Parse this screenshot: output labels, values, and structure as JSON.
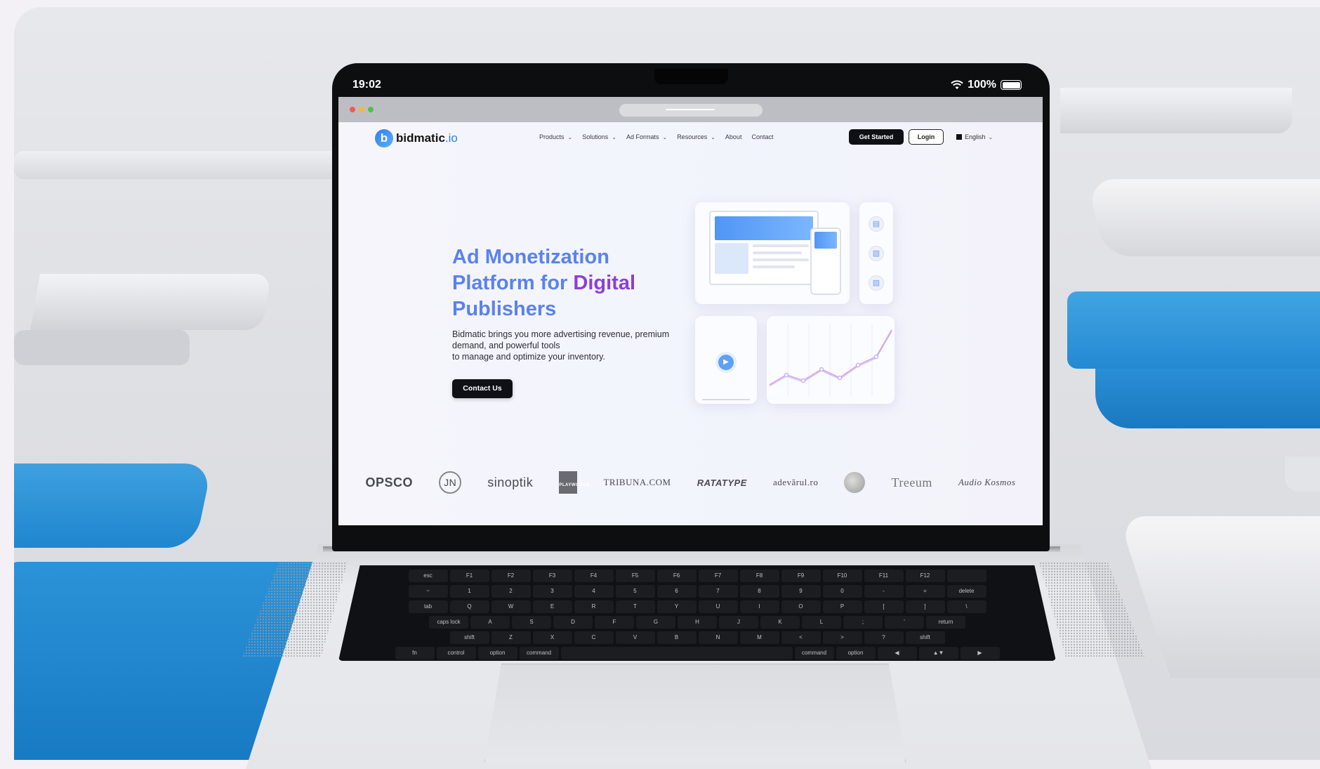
{
  "status_bar": {
    "time": "19:02",
    "battery": "100%"
  },
  "site": {
    "logo_mark": "b",
    "logo_name": "bidmatic",
    "logo_tld": ".io",
    "nav": [
      {
        "label": "Products",
        "dropdown": true
      },
      {
        "label": "Solutions",
        "dropdown": true
      },
      {
        "label": "Ad Formats",
        "dropdown": true
      },
      {
        "label": "Resources",
        "dropdown": true
      },
      {
        "label": "About",
        "dropdown": false
      },
      {
        "label": "Contact",
        "dropdown": false
      }
    ],
    "get_started": "Get Started",
    "login": "Login",
    "language": "English",
    "hero": {
      "title_part1": "Ad Monetization Platform for ",
      "title_highlight": "Digital",
      "title_part2": " Publishers",
      "desc_line1": "Bidmatic brings you more advertising revenue, premium demand, and powerful tools",
      "desc_line2": "to manage and optimize your inventory.",
      "cta": "Contact Us"
    },
    "partner_logos": [
      "OPSCO",
      "JN",
      "sinoptik",
      "PLAYWORKS",
      "TRIBUNA.COM",
      "RATATYPE",
      "adevărul.ro",
      "Treeum",
      "Audio Kosmos"
    ]
  },
  "colors": {
    "accent_blue": "#5a82ee",
    "accent_purple": "#8b3fd9",
    "dark_button": "#0f1016"
  }
}
